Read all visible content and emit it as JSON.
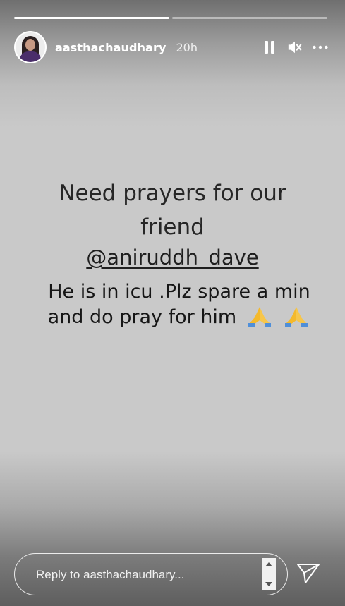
{
  "story": {
    "progress": [
      {
        "fraction": 1.0
      },
      {
        "fraction": 0.0
      }
    ],
    "user": {
      "username": "aasthachaudhary",
      "time": "20h",
      "avatar_icon": "profile-avatar"
    },
    "controls": {
      "pause_icon": "pause-icon",
      "mute_icon": "muted-speaker-icon",
      "more_icon": "more-options-icon"
    },
    "text": {
      "line1": "Need prayers for our",
      "line2": "friend",
      "mention": "@aniruddh_dave",
      "message_line1": "He is in icu .Plz spare a min",
      "message_line2": "and do pray for him",
      "emoji_name": "folded-hands"
    },
    "reply": {
      "placeholder": "Reply to aasthachaudhary..."
    },
    "colors": {
      "background": "#c9c9c9",
      "text": "#262626",
      "emoji": "#f4b92b"
    }
  }
}
